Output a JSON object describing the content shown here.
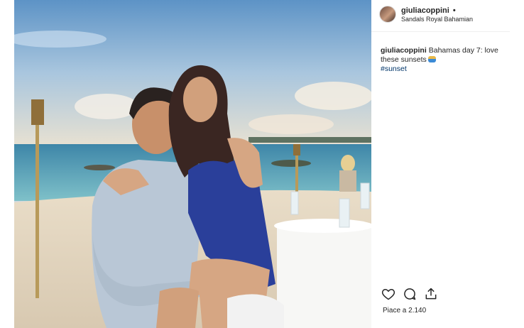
{
  "post": {
    "username": "giuliacoppini",
    "follow_dot": "•",
    "location": "Sandals Royal Bahamian",
    "caption_user": "giuliacoppini",
    "caption_text": "Bahamas day 7: love these sunsets",
    "hashtag": "#sunset",
    "likes_text": "Piace a 2.140"
  },
  "icons": {
    "like": "heart-icon",
    "comment": "comment-icon",
    "share": "share-icon"
  },
  "colors": {
    "text": "#262626",
    "hashtag": "#003569",
    "divider": "#efefef"
  }
}
